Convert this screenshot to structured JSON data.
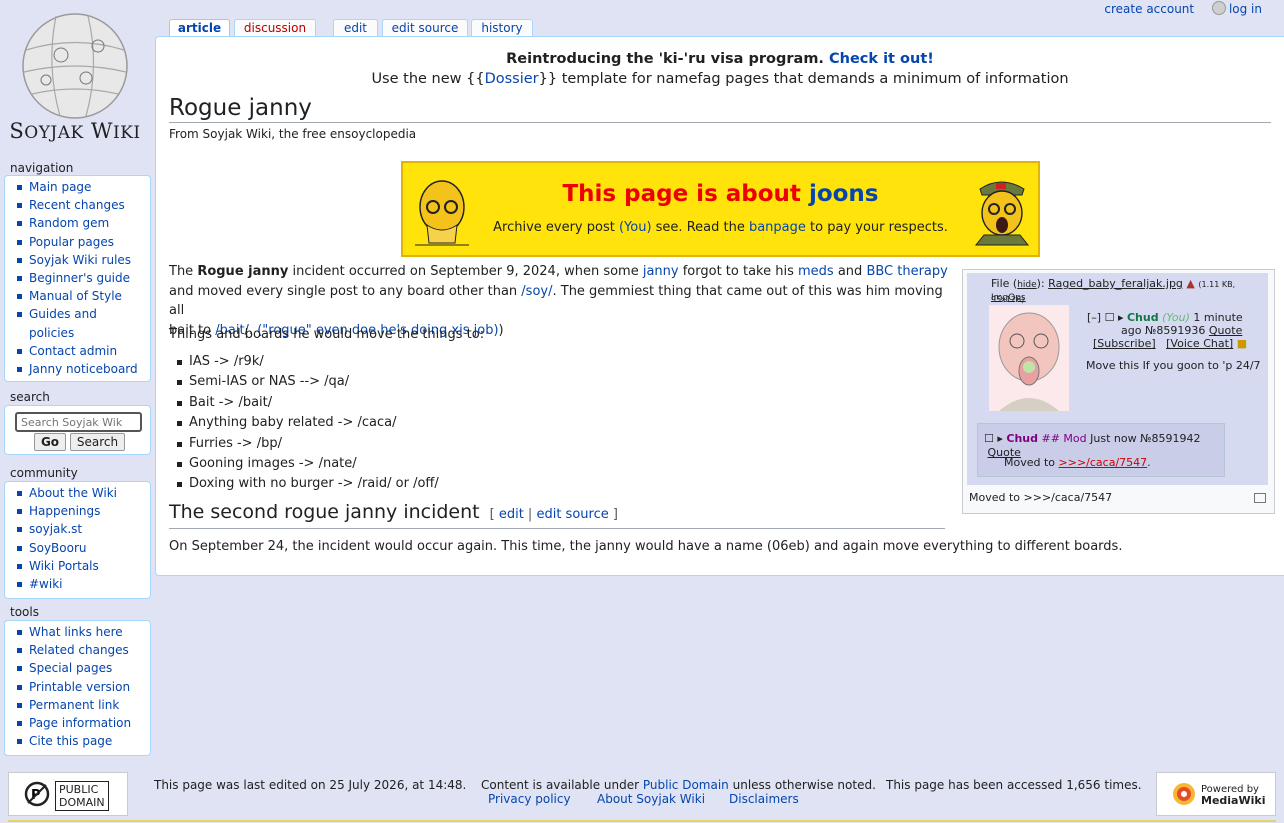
{
  "personal": {
    "create_account": "create account",
    "log_in": "log in"
  },
  "logo": {
    "first": "S",
    "soyjak": "OYJAK",
    "w": " W",
    "iki": "IKI"
  },
  "tabs": {
    "article": "article",
    "discussion": "discussion",
    "edit": "edit",
    "edit_source": "edit source",
    "history": "history"
  },
  "sidebar": {
    "navigation": {
      "heading": "navigation",
      "items": [
        "Main page",
        "Recent changes",
        "Random gem",
        "Popular pages",
        "Soyjak Wiki rules",
        "Beginner's guide",
        "Manual of Style",
        "Guides and",
        "policies",
        "Contact admin",
        "Janny noticeboard"
      ]
    },
    "search": {
      "heading": "search",
      "placeholder": "Search Soyjak Wik",
      "go": "Go",
      "search": "Search"
    },
    "community": {
      "heading": "community",
      "items": [
        "About the Wiki",
        "Happenings",
        "soyjak.st",
        "SoyBooru",
        "Wiki Portals",
        "#wiki"
      ]
    },
    "tools": {
      "heading": "tools",
      "items": [
        "What links here",
        "Related changes",
        "Special pages",
        "Printable version",
        "Permanent link",
        "Page information",
        "Cite this page"
      ]
    }
  },
  "notice": {
    "l1a": "Reintroducing the 'ki-'ru visa program. ",
    "l1b": "Check it out!",
    "l2a": "Use the new {{",
    "l2b": "Dossier",
    "l2c": "}} template for namefag pages that demands a minimum of information"
  },
  "title": "Rogue janny",
  "site_sub": "From Soyjak Wiki, the free ensoyclopedia",
  "banner": {
    "a": "This page is about ",
    "b": "joons",
    "c": "Archive every post ",
    "d": "(You)",
    "e": " see. Read the ",
    "f": "banpage",
    "g": " to pay your respects."
  },
  "p1": {
    "a": "The ",
    "b": "Rogue janny",
    "c": " incident occurred on September 9, 2024, when some ",
    "d": "janny",
    "e": " forgot to take his ",
    "f": "meds",
    "g": " and ",
    "h": "BBC therapy",
    "i": "and moved every single post to any board other than ",
    "j": "/soy/",
    "k": ". The gemmiest thing that came out of this was him moving all",
    "l": "bait to ",
    "m": "/bait/",
    "n": ". ",
    "o": "(\"rogue\" even doe he's doing xis job)",
    "p": ")"
  },
  "p2": "Things and boards he would move the things to:",
  "list": [
    "IAS -> /r9k/",
    "Semi-IAS or NAS --> /qa/",
    "Bait -> /bait/",
    "Anything baby related -> /caca/",
    "Furries -> /bp/",
    "Gooning images -> /nate/",
    "Doxing with no burger -> /raid/ or /off/"
  ],
  "h2": {
    "title": "The second rogue janny incident",
    "lb": "[ ",
    "edit": "edit",
    "sep": " | ",
    "edit_source": "edit source",
    "rb": " ]"
  },
  "p3": "On September 24, the incident would occur again. This time, the janny would have a name (06eb) and again move everything to different boards.",
  "thumb": {
    "file": "File (",
    "hide": "hide",
    "file2": "): ",
    "filename": "Raged_baby_feraljak.jpg",
    "meta": "(1.11 KB, 95x126)",
    "imgops": "ImgOps",
    "post1": {
      "collapse": "[–]",
      "name": "Chud",
      "you": "(You)",
      "time": "1 minute",
      "ago": "ago №8591936",
      "quote": "Quote",
      "subscribe": "[Subscribe]",
      "voice": "[Voice Chat]",
      "text": "Move this If you goon to 'p 24/7"
    },
    "post2": {
      "name": "Chud",
      "mod": "## Mod",
      "time": "Just now №8591942",
      "quote": "Quote",
      "moved": "Moved to ",
      "link": ">>>/caca/7547",
      "dot": "."
    },
    "caption": "Moved to >>>/caca/7547"
  },
  "footer": {
    "pd1": "PUBLIC",
    "pd2": "DOMAIN",
    "edited": "This page was last edited on 25 July 2026, at 14:48.",
    "content_a": "Content is available under ",
    "content_b": "Public Domain",
    "content_c": " unless otherwise noted.",
    "accessed": "This page has been accessed 1,656 times.",
    "privacy": "Privacy policy",
    "about": "About Soyjak Wiki",
    "disclaimers": "Disclaimers",
    "mw1": "Powered by",
    "mw2": "MediaWiki"
  }
}
